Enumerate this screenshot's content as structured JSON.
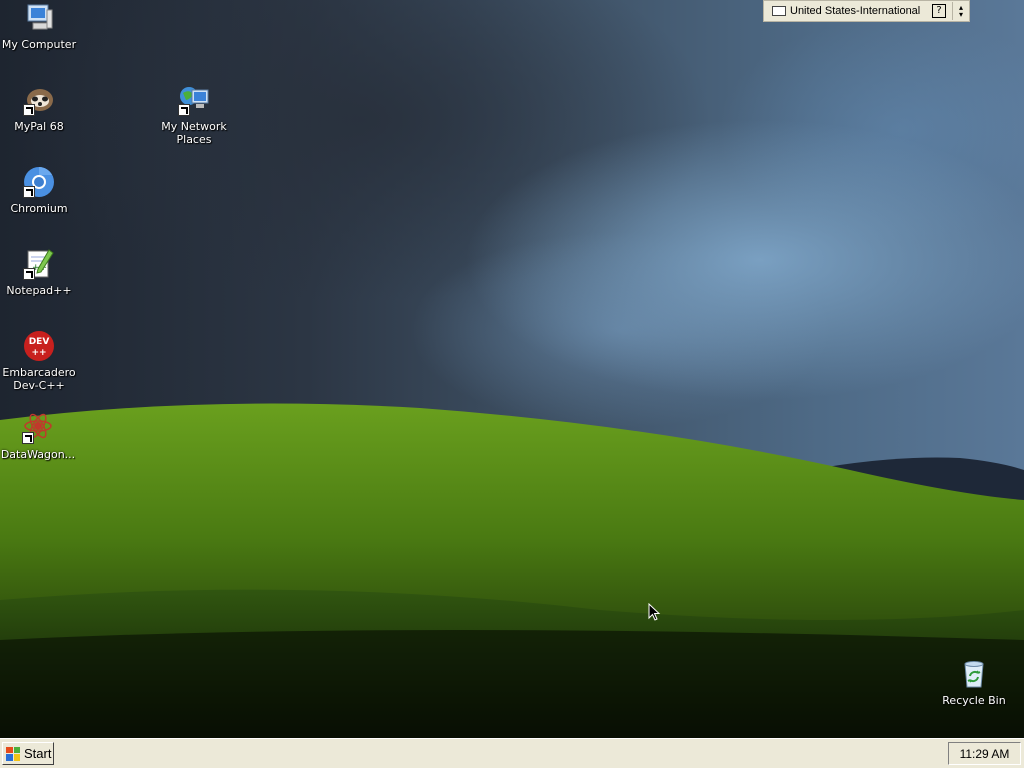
{
  "desktop": {
    "icons": [
      {
        "label": "My Computer"
      },
      {
        "label": "MyPal 68"
      },
      {
        "label": "My Network\nPlaces"
      },
      {
        "label": "Chromium"
      },
      {
        "label": "Notepad++"
      },
      {
        "label": "Embarcadero\nDev-C++"
      },
      {
        "label": "DataWagon..."
      },
      {
        "label": "Recycle Bin"
      }
    ],
    "icon_names": [
      "computer-icon",
      "mypal-icon",
      "network-places-icon",
      "chromium-icon",
      "notepad-plus-plus-icon",
      "dev-cpp-icon",
      "datawagon-icon",
      "recycle-bin-icon"
    ],
    "devcpp_badge": "DEV\n++"
  },
  "language_bar": {
    "language": "United States-International",
    "help_glyph": "?"
  },
  "taskbar": {
    "start_label": "Start",
    "clock": "11:29 AM"
  },
  "colors": {
    "taskbar_bg": "#ece9d8",
    "grass": "#4a7a12",
    "sky": "#4e6a86"
  }
}
